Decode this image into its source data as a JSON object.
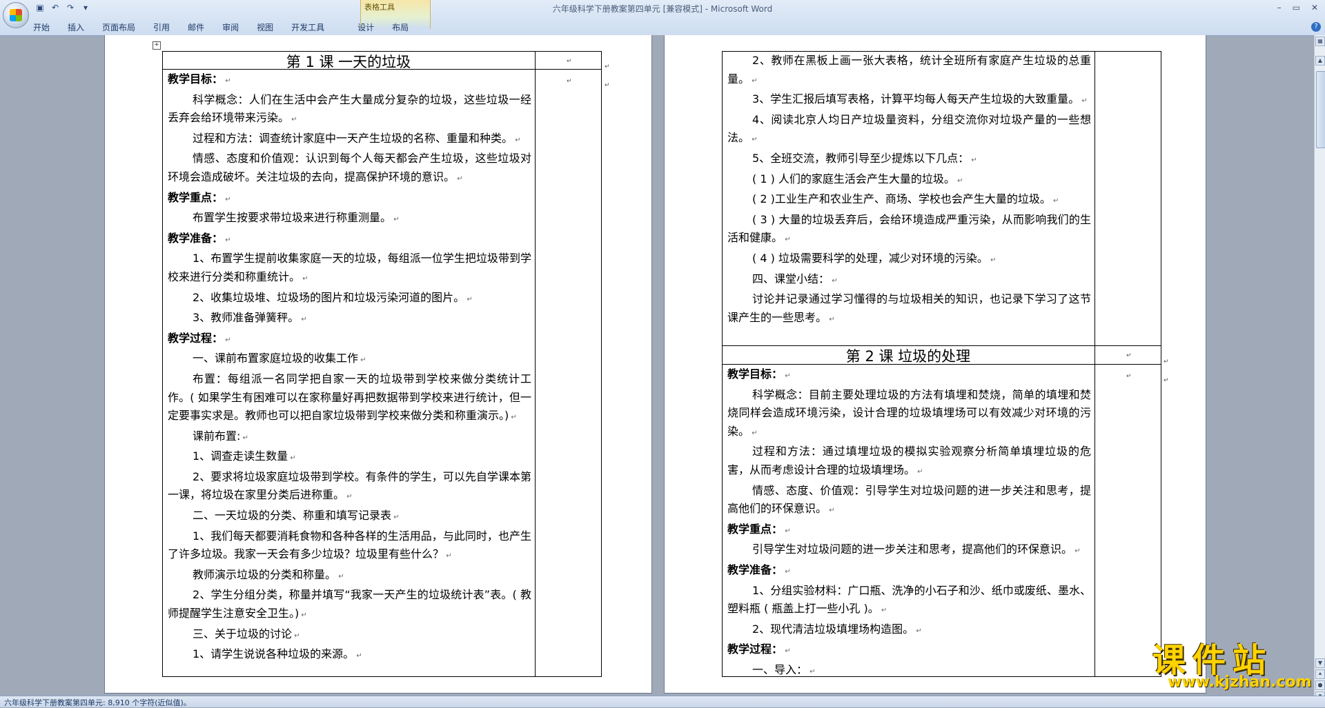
{
  "window": {
    "title": "六年级科学下册教案第四单元 [兼容模式] - Microsoft Word",
    "context_tab_group": "表格工具",
    "controls": [
      "–",
      "▭",
      "✕"
    ],
    "help": "?"
  },
  "quick_access": [
    "save-icon",
    "undo-icon",
    "redo-icon",
    "customize-icon"
  ],
  "ribbon_tabs": [
    "开始",
    "插入",
    "页面布局",
    "引用",
    "邮件",
    "审阅",
    "视图",
    "开发工具",
    "设计",
    "布局"
  ],
  "page1": {
    "lesson_title": "第 1 课  一天的垃圾",
    "lines": [
      {
        "t": "教学目标：",
        "h": true
      },
      {
        "t": "科学概念：人们在生活中会产生大量成分复杂的垃圾，这些垃圾一经丢弃会给环境带来污染。",
        "i": true
      },
      {
        "t": "过程和方法：调查统计家庭中一天产生垃圾的名称、重量和种类。",
        "i": true
      },
      {
        "t": "情感、态度和价值观：认识到每个人每天都会产生垃圾，这些垃圾对环境会造成破坏。关注垃圾的去向，提高保护环境的意识。",
        "i": true
      },
      {
        "t": "教学重点：",
        "h": true
      },
      {
        "t": "布置学生按要求带垃圾来进行称重测量。",
        "i": true
      },
      {
        "t": "教学准备：",
        "h": true
      },
      {
        "t": "1、布置学生提前收集家庭一天的垃圾，每组派一位学生把垃圾带到学校来进行分类和称重统计。",
        "i": true
      },
      {
        "t": "2、收集垃圾堆、垃圾场的图片和垃圾污染河道的图片。",
        "i": true
      },
      {
        "t": "3、教师准备弹簧秤。",
        "i": true
      },
      {
        "t": "教学过程：",
        "h": true
      },
      {
        "t": "一、课前布置家庭垃圾的收集工作",
        "i": true
      },
      {
        "t": "布置：每组派一名同学把自家一天的垃圾带到学校来做分类统计工作。( 如果学生有困难可以在家称量好再把数据带到学校来进行统计，但一定要事实求是。教师也可以把自家垃圾带到学校来做分类和称重演示。)",
        "i": true
      },
      {
        "t": "课前布置:",
        "i": true
      },
      {
        "t": "1、调查走读生数量",
        "i": true
      },
      {
        "t": "2、要求将垃圾家庭垃圾带到学校。有条件的学生，可以先自学课本第一课，将垃圾在家里分类后进称重。",
        "i": true
      },
      {
        "t": "二、一天垃圾的分类、称重和填写记录表",
        "i": true
      },
      {
        "t": "1、我们每天都要消耗食物和各种各样的生活用品，与此同时，也产生了许多垃圾。我家一天会有多少垃圾？垃圾里有些什么？",
        "i": true
      },
      {
        "t": "教师演示垃圾的分类和称量。",
        "i": true
      },
      {
        "t": "2、学生分组分类，称量并填写“我家一天产生的垃圾统计表”表。( 教师提醒学生注意安全卫生。)",
        "i": true
      },
      {
        "t": "三、关于垃圾的讨论",
        "i": true
      },
      {
        "t": "1、请学生说说各种垃圾的来源。",
        "i": true
      }
    ]
  },
  "page2": {
    "lines_top": [
      {
        "t": "2、教师在黑板上画一张大表格，统计全班所有家庭产生垃圾的总重量。",
        "i": true
      },
      {
        "t": "3、学生汇报后填写表格，计算平均每人每天产生垃圾的大致重量。",
        "i": true
      },
      {
        "t": "4、阅读北京人均日产垃圾量资料，分组交流你对垃圾产量的一些想法。",
        "i": true
      },
      {
        "t": "5、全班交流，教师引导至少提炼以下几点：",
        "i": true
      },
      {
        "t": "( 1 ) 人们的家庭生活会产生大量的垃圾。",
        "i": true
      },
      {
        "t": "( 2 )工业生产和农业生产、商场、学校也会产生大量的垃圾。",
        "i": true
      },
      {
        "t": "( 3 ) 大量的垃圾丢弃后，会给环境造成严重污染，从而影响我们的生活和健康。",
        "i": true
      },
      {
        "t": "( 4 ) 垃圾需要科学的处理，减少对环境的污染。",
        "i": true
      },
      {
        "t": "四、课堂小结：",
        "i": true
      },
      {
        "t": "讨论并记录通过学习懂得的与垃圾相关的知识，也记录下学习了这节课产生的一些思考。",
        "i": true
      }
    ],
    "lesson_title": "第 2 课  垃圾的处理",
    "lines_bottom": [
      {
        "t": "教学目标：",
        "h": true
      },
      {
        "t": "科学概念：目前主要处理垃圾的方法有填埋和焚烧，简单的填埋和焚烧同样会造成环境污染，设计合理的垃圾填埋场可以有效减少对环境的污染。",
        "i": true
      },
      {
        "t": "过程和方法：通过填埋垃圾的模拟实验观察分析简单填埋垃圾的危害，从而考虑设计合理的垃圾填埋场。",
        "i": true
      },
      {
        "t": "情感、态度、价值观：引导学生对垃圾问题的进一步关注和思考，提高他们的环保意识。",
        "i": true
      },
      {
        "t": "教学重点：",
        "h": true
      },
      {
        "t": "引导学生对垃圾问题的进一步关注和思考，提高他们的环保意识。",
        "i": true
      },
      {
        "t": "教学准备：",
        "h": true
      },
      {
        "t": "1、分组实验材料：广口瓶、洗净的小石子和沙、纸巾或废纸、墨水、塑料瓶 ( 瓶盖上打一些小孔 )。",
        "i": true
      },
      {
        "t": "2、现代清洁垃圾填埋场构造图。",
        "i": true
      },
      {
        "t": "教学过程：",
        "h": true
      },
      {
        "t": "一、导入：",
        "i": true
      }
    ]
  },
  "status": "六年级科学下册教案第四单元: 8,910 个字符(近似值)。",
  "watermark": {
    "chinese": "课件站",
    "url": "www.kjzhan.com"
  },
  "colors": {
    "ribbon": "#d5e2f4",
    "context_tab": "#f7e6a8",
    "watermark": "#ffd300"
  }
}
